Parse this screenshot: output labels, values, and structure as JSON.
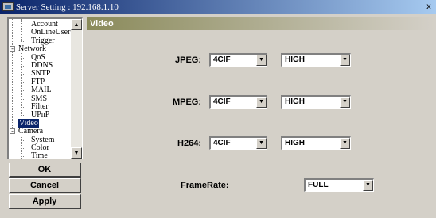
{
  "window": {
    "title": "Server Setting : 192.168.1.10",
    "close_label": "x"
  },
  "tree": {
    "items": [
      {
        "label": "Account",
        "level": 1
      },
      {
        "label": "OnLineUser",
        "level": 1
      },
      {
        "label": "Trigger",
        "level": 1
      },
      {
        "label": "Network",
        "level": 0,
        "toggle": "-"
      },
      {
        "label": "QoS",
        "level": 1
      },
      {
        "label": "DDNS",
        "level": 1
      },
      {
        "label": "SNTP",
        "level": 1
      },
      {
        "label": "FTP",
        "level": 1
      },
      {
        "label": "MAIL",
        "level": 1
      },
      {
        "label": "SMS",
        "level": 1
      },
      {
        "label": "Filter",
        "level": 1
      },
      {
        "label": "UPnP",
        "level": 1
      },
      {
        "label": "Video",
        "level": 0,
        "selected": true
      },
      {
        "label": "Camera",
        "level": 0,
        "toggle": "-"
      },
      {
        "label": "System",
        "level": 1
      },
      {
        "label": "Color",
        "level": 1
      },
      {
        "label": "Time",
        "level": 1
      }
    ]
  },
  "buttons": {
    "ok": "OK",
    "cancel": "Cancel",
    "apply": "Apply"
  },
  "panel": {
    "header": "Video",
    "jpeg": {
      "label": "JPEG:",
      "resolution": "4CIF",
      "quality": "HIGH"
    },
    "mpeg": {
      "label": "MPEG:",
      "resolution": "4CIF",
      "quality": "HIGH"
    },
    "h264": {
      "label": "H264:",
      "resolution": "4CIF",
      "quality": "HIGH"
    },
    "framerate": {
      "label": "FrameRate:",
      "value": "FULL"
    }
  },
  "colors": {
    "title_start": "#0a246a",
    "panel_header": "#8a8a5a",
    "selected": "#0a246a",
    "face": "#d4d0c8"
  }
}
